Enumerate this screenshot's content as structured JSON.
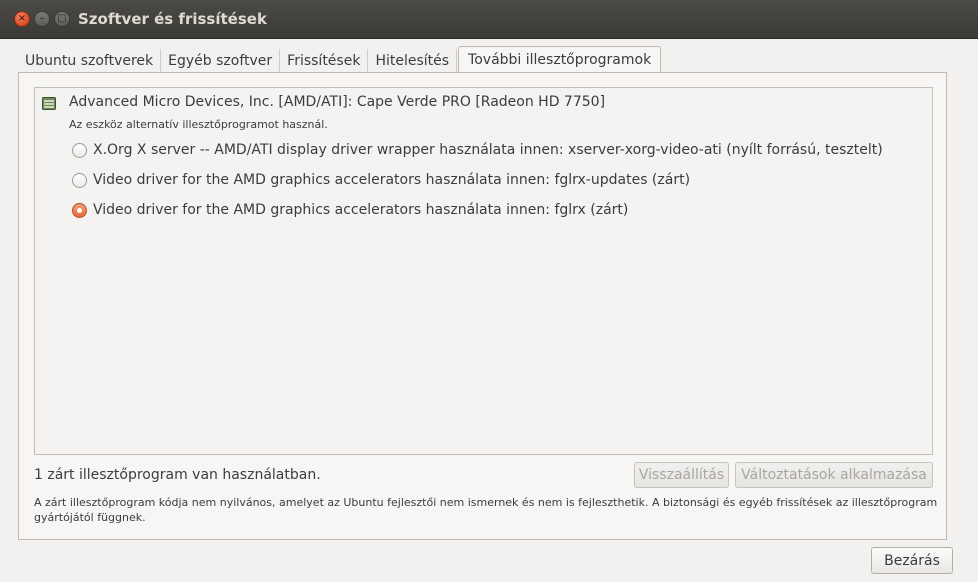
{
  "window": {
    "title": "Szoftver és frissítések",
    "controls": {
      "close": "×",
      "minimize": "–",
      "maximize": "□"
    }
  },
  "tabs": [
    {
      "label": "Ubuntu szoftverek",
      "active": false
    },
    {
      "label": "Egyéb szoftver",
      "active": false
    },
    {
      "label": "Frissítések",
      "active": false
    },
    {
      "label": "Hitelesítés",
      "active": false
    },
    {
      "label": "További illesztőprogramok",
      "active": true
    }
  ],
  "device": {
    "icon": "video-card-icon",
    "name": "Advanced Micro Devices, Inc. [AMD/ATI]: Cape Verde PRO [Radeon HD 7750]",
    "status": "Az eszköz alternatív illesztőprogramot használ.",
    "drivers": [
      {
        "label": "X.Org X server -- AMD/ATI display driver wrapper használata innen: xserver-xorg-video-ati (nyílt forrású, tesztelt)",
        "selected": false
      },
      {
        "label": "Video driver for the AMD graphics accelerators használata innen: fglrx-updates (zárt)",
        "selected": false
      },
      {
        "label": "Video driver for the AMD graphics accelerators használata innen: fglrx (zárt)",
        "selected": true
      }
    ]
  },
  "footer": {
    "status": "1 zárt illesztőprogram van használatban.",
    "revert_label": "Visszaállítás",
    "apply_label": "Változtatások alkalmazása",
    "note": "A zárt illesztőprogram kódja nem nyilvános, amelyet az Ubuntu fejlesztői nem ismernek és nem is fejleszthetik. A biztonsági és egyéb frissítések az illesztőprogram gyártójától függnek."
  },
  "dialog": {
    "close_label": "Bezárás"
  },
  "colors": {
    "accent": "#e66b37",
    "titlebar": "#3b3a36",
    "window_bg": "#f2f1f0"
  }
}
